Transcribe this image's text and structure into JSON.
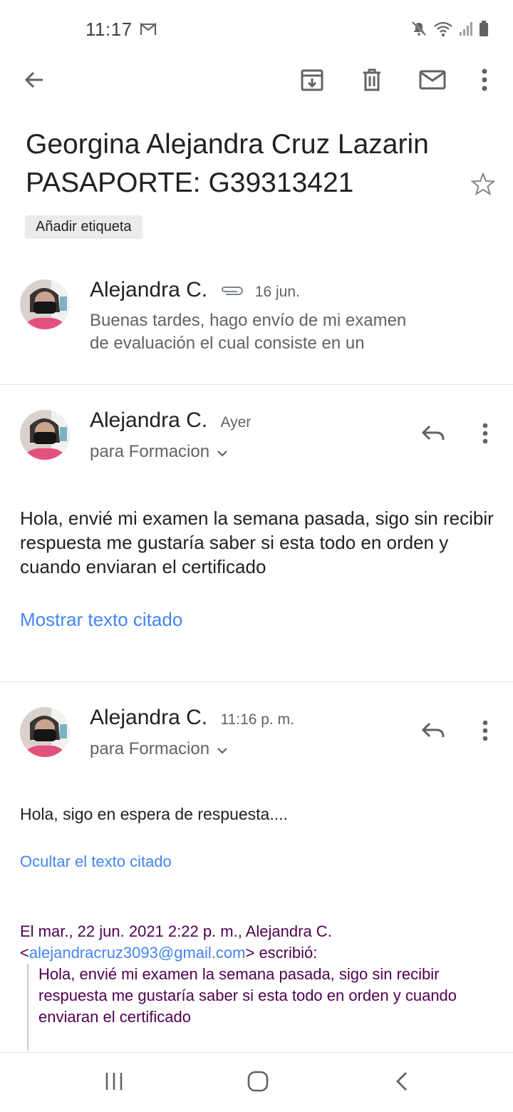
{
  "status_bar": {
    "time": "11:17"
  },
  "subject": "Georgina Alejandra Cruz Lazarin PASAPORTE: G39313421",
  "label_chip": "Añadir etiqueta",
  "messages": [
    {
      "sender": "Alejandra C.",
      "time": "16 jun.",
      "snippet_line1": "Buenas tardes, hago envío de mi examen",
      "snippet_line2": "de evaluación el cual consiste en un"
    },
    {
      "sender": "Alejandra C.",
      "time": "Ayer",
      "recipients": "para Formacion",
      "body": "Hola, envié mi examen la semana pasada, sigo sin recibir respuesta me gustaría saber si esta todo en orden y cuando enviaran el certificado",
      "quote_toggle": "Mostrar texto citado"
    },
    {
      "sender": "Alejandra C.",
      "time": "11:16 p. m.",
      "recipients": "para Formacion",
      "body": "Hola, sigo en espera de respuesta....",
      "quote_toggle": "Ocultar el texto citado",
      "quote_header_prefix": "El mar., 22 jun. 2021 2:22 p. m., Alejandra C.",
      "quote_email": "alejandracruz3093@gmail.com",
      "quote_header_suffix": "escribió:",
      "quoted_body": "Hola, envié mi examen la semana pasada, sigo sin recibir respuesta me gustaría saber si esta todo en orden y cuando enviaran el certificado"
    }
  ],
  "icons": {
    "toolbar": [
      "back-arrow-icon",
      "archive-icon",
      "trash-icon",
      "mark-unread-icon",
      "more-vert-icon"
    ],
    "nav": [
      "recent-apps-icon",
      "home-icon",
      "nav-back-icon"
    ]
  },
  "colors": {
    "link": "#4285f4",
    "quote": "#500050",
    "chip": "#ebebeb"
  }
}
